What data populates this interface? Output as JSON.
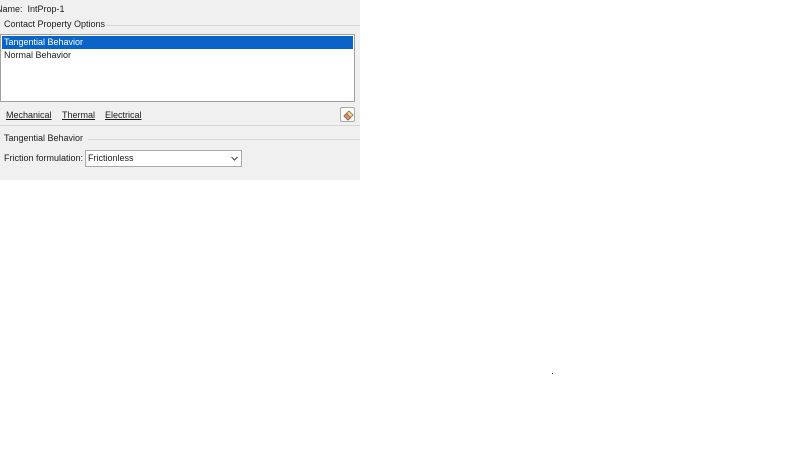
{
  "name_field": {
    "label": "Name:",
    "value": "IntProp-1"
  },
  "contact_options": {
    "group_label": "Contact Property Options",
    "items": [
      {
        "label": "Tangential Behavior",
        "selected": true
      },
      {
        "label": "Normal Behavior",
        "selected": false
      }
    ]
  },
  "menu": {
    "items": [
      {
        "label": "Mechanical"
      },
      {
        "label": "Thermal"
      },
      {
        "label": "Electrical"
      }
    ],
    "eraser_icon": "eraser-icon"
  },
  "tangential_section": {
    "title": "Tangential Behavior",
    "friction_label": "Friction formulation:",
    "friction_value": "Frictionless"
  },
  "colors": {
    "panel_bg": "#f0f0f0",
    "selection": "#0a64c8"
  }
}
